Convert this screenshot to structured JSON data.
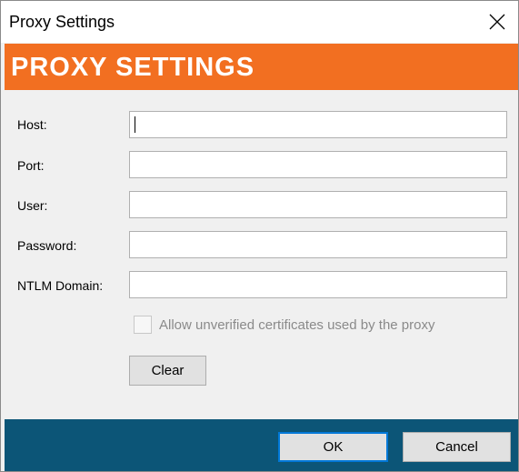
{
  "window": {
    "title": "Proxy Settings"
  },
  "banner": {
    "title": "PROXY SETTINGS"
  },
  "form": {
    "host_label": "Host:",
    "host_value": "",
    "port_label": "Port:",
    "port_value": "",
    "user_label": "User:",
    "user_value": "",
    "password_label": "Password:",
    "password_value": "",
    "ntlm_label": "NTLM Domain:",
    "ntlm_value": "",
    "allow_unverified_label": "Allow unverified certificates used by the proxy",
    "allow_unverified_checked": false,
    "allow_unverified_enabled": false
  },
  "buttons": {
    "clear": "Clear",
    "ok": "OK",
    "cancel": "Cancel"
  },
  "colors": {
    "banner": "#f26f21",
    "footer": "#0c5577",
    "default_button_border": "#0078d7"
  },
  "icons": {
    "close": "close-icon"
  }
}
